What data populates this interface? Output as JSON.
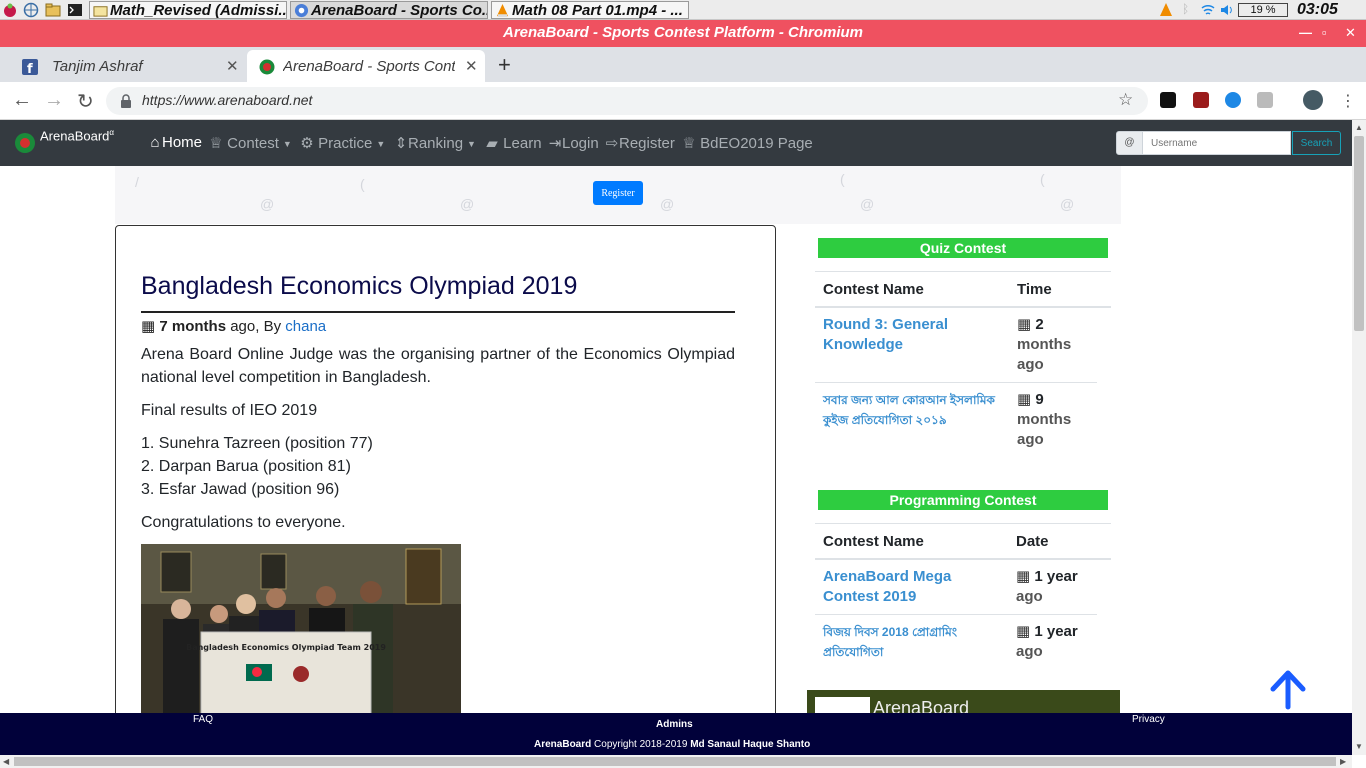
{
  "taskbar": {
    "tasks": [
      {
        "label": "Math_Revised (Admissi...",
        "icon": "folder-icon"
      },
      {
        "label": "ArenaBoard - Sports Co...",
        "icon": "chromium-icon"
      },
      {
        "label": "Math 08 Part 01.mp4 - ...",
        "icon": "vlc-icon"
      }
    ],
    "battery": "19 %",
    "clock": "03:05"
  },
  "window": {
    "title": "ArenaBoard - Sports Contest Platform - Chromium"
  },
  "browser": {
    "tabs": [
      {
        "label": "Tanjim Ashraf",
        "icon": "facebook-icon",
        "active": false
      },
      {
        "label": "ArenaBoard - Sports Conte",
        "icon": "arenaboard-favicon",
        "active": true
      }
    ],
    "close_glyph": "✕",
    "newtab_glyph": "+",
    "url": "https://www.arenaboard.net"
  },
  "site": {
    "brand": "ArenaBoard",
    "brand_sup": "α",
    "nav": {
      "home": "Home",
      "contest": "Contest",
      "practice": "Practice",
      "ranking": "Ranking",
      "learn": "Learn",
      "login": "Login",
      "register": "Register",
      "bdeo": "BdEO2019 Page"
    },
    "search": {
      "at": "@",
      "placeholder": "Username",
      "button": "Search"
    },
    "hero": {
      "register_button": "Register"
    }
  },
  "post": {
    "title": "Bangladesh Economics Olympiad 2019",
    "meta_time": "7 months",
    "meta_ago": "ago, By",
    "author": "chana",
    "intro": "Arena Board Online Judge was the organising partner of the Economics Olympiad national level competition in Bangladesh.",
    "results_heading": "Final results of IEO 2019",
    "results": [
      "1. Sunehra Tazreen (position 77)",
      "2. Darpan Barua (position 81)",
      "3. Esfar Jawad (position 96)"
    ],
    "closing": "Congratulations to everyone.",
    "photo_banner_text": "Bangladesh Economics Olympiad Team 2019"
  },
  "sidebar": {
    "quiz": {
      "heading": "Quiz Contest",
      "col_name": "Contest Name",
      "col_time": "Time",
      "rows": [
        {
          "name": "Round 3: General Knowledge",
          "time_num": "2",
          "time_unit": "months ago"
        },
        {
          "name": "সবার জন্য আল কোরআন ইসলামিক কুইজ প্রতিযোগিতা ২০১৯",
          "time_num": "9",
          "time_unit": "months ago"
        }
      ]
    },
    "programming": {
      "heading": "Programming Contest",
      "col_name": "Contest Name",
      "col_time": "Date",
      "rows": [
        {
          "name": "ArenaBoard Mega Contest 2019",
          "time_num": "1 year",
          "time_unit": "ago"
        },
        {
          "name": "বিজয় দিবস 2018 প্রোগ্রামিং প্রতিযোগিতা",
          "time_num": "1 year",
          "time_unit": "ago"
        }
      ]
    },
    "fb_widget_name": "ArenaBoard"
  },
  "footer": {
    "faq": "FAQ",
    "admins": "Admins",
    "privacy": "Privacy",
    "copyright_brand": "ArenaBoard",
    "copyright_text": "Copyright 2018-2019",
    "copyright_owner": "Md Sanaul Haque Shanto"
  },
  "colors": {
    "titlebar": "#ef5160",
    "navbar": "#343a40",
    "sidebar_heading": "#2ecc40",
    "footer": "#01013a",
    "link": "#3a8fd0",
    "primary_button": "#007bff"
  }
}
